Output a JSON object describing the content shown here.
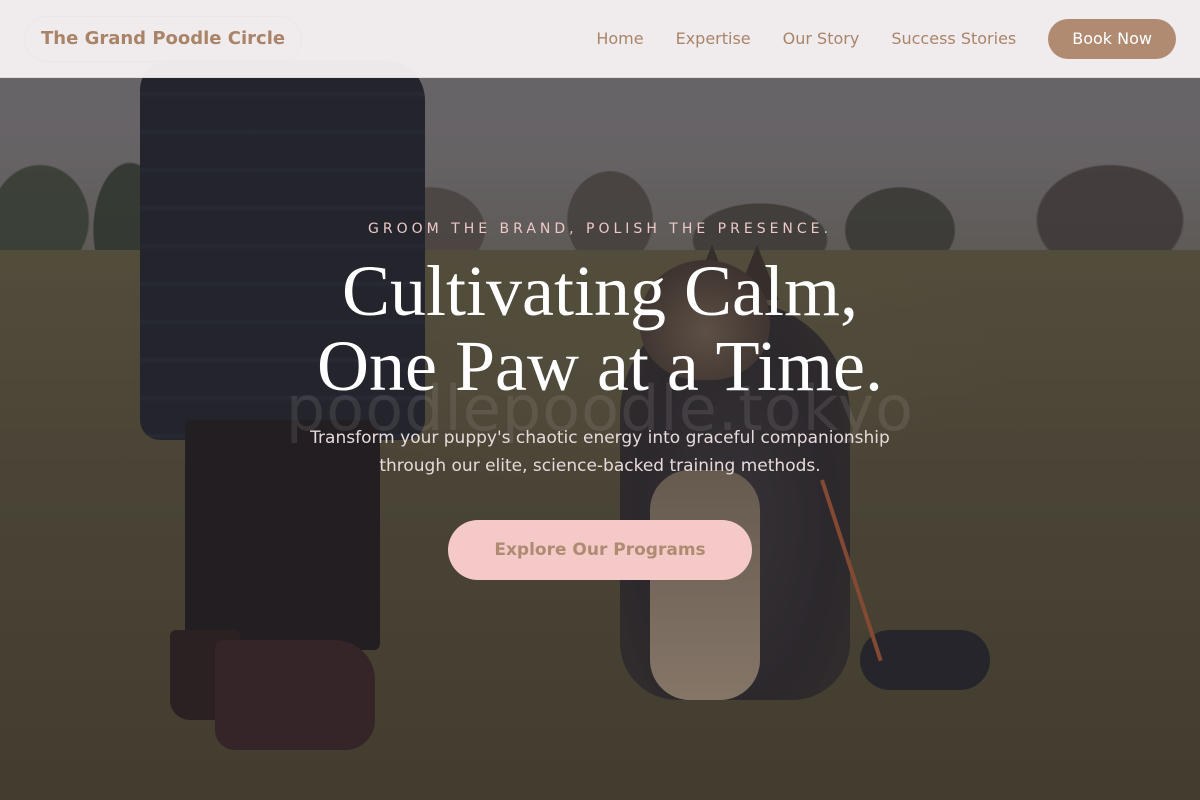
{
  "navbar": {
    "brand": "The Grand Poodle Circle",
    "links": [
      "Home",
      "Expertise",
      "Our Story",
      "Success Stories"
    ],
    "cta_label": "Book Now"
  },
  "hero": {
    "eyebrow": "GROOM THE BRAND, POLISH THE PRESENCE.",
    "headline_line1": "Cultivating Calm,",
    "headline_line2": "One Paw at a Time.",
    "watermark": "poodlepoodle.tokyo",
    "subtitle_line1": "Transform your puppy's chaotic energy into graceful companionship",
    "subtitle_line2": "through our elite, science-backed training methods.",
    "cta_label": "Explore Our Programs",
    "background_image": "person-with-german-shepherd-in-park"
  },
  "colors": {
    "brand": "#a98469",
    "button_primary": "#b08b72",
    "cta_background": "#f4c9c8",
    "eyebrow": "#ecc9c6",
    "navbar_background": "#f6f1f2"
  }
}
